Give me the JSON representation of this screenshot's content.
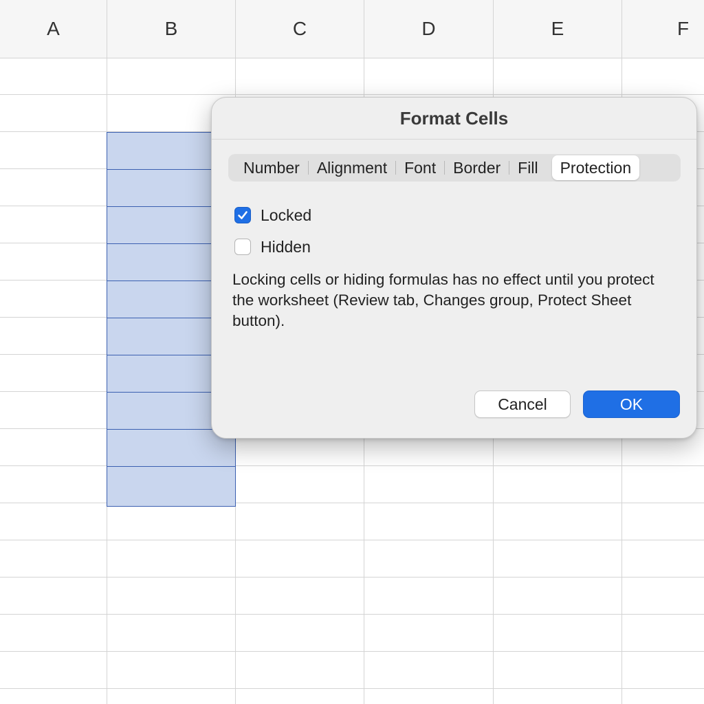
{
  "sheet": {
    "columns": [
      "A",
      "B",
      "C",
      "D",
      "E",
      "F"
    ],
    "selection_color": "#c9d6ee",
    "selection_border_color": "#3a5fb0"
  },
  "dialog": {
    "title": "Format Cells",
    "tabs": [
      {
        "label": "Number",
        "active": false
      },
      {
        "label": "Alignment",
        "active": false
      },
      {
        "label": "Font",
        "active": false
      },
      {
        "label": "Border",
        "active": false
      },
      {
        "label": "Fill",
        "active": false
      },
      {
        "label": "Protection",
        "active": true
      }
    ],
    "options": [
      {
        "label": "Locked",
        "checked": true
      },
      {
        "label": "Hidden",
        "checked": false
      }
    ],
    "description": "Locking cells or hiding formulas has no effect until you protect the worksheet (Review tab, Changes group, Protect Sheet button).",
    "cancel_label": "Cancel",
    "ok_label": "OK",
    "accent_color": "#1f6fe5"
  }
}
